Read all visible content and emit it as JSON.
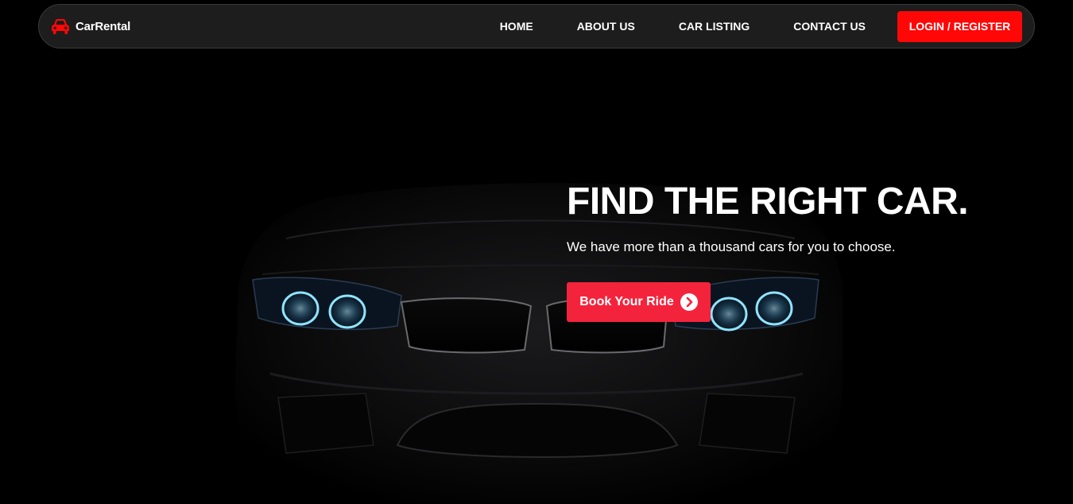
{
  "brand": {
    "name": "CarRental",
    "icon": "car-icon",
    "accent_color": "#ff0707"
  },
  "nav": {
    "links": [
      {
        "label": "HOME"
      },
      {
        "label": "ABOUT US"
      },
      {
        "label": "CAR LISTING"
      },
      {
        "label": "CONTACT US"
      }
    ],
    "login_label": "LOGIN / REGISTER",
    "login_color": "#ff0707"
  },
  "hero": {
    "title": "FIND THE RIGHT CAR.",
    "subtitle": "We have more than a thousand cars for you to choose.",
    "cta_label": "Book Your Ride",
    "cta_icon": "chevron-right-circle-icon",
    "cta_color": "#f4233c",
    "headlight_color": "#6fd3ff"
  }
}
